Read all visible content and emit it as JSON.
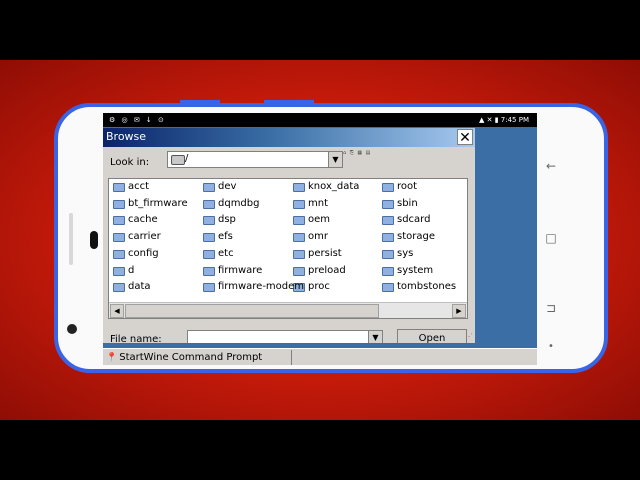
{
  "status_bar": {
    "left_icons": "⚙ ◎ ✉ ↓ ⊙",
    "right_text": "▲ ✕ ▮ 7:45 PM"
  },
  "dialog": {
    "title": "Browse",
    "close_glyph": "✕",
    "look_in_label": "Look in:",
    "look_in_value": "/",
    "toolbar_icons": "⌂ ⎘ ▦ ▤",
    "file_name_label": "File name:",
    "file_name_value": "",
    "open_button": "Open",
    "folders": [
      "acct",
      "bt_firmware",
      "cache",
      "carrier",
      "config",
      "d",
      "data",
      "dev",
      "dqmdbg",
      "dsp",
      "efs",
      "etc",
      "firmware",
      "firmware-modem",
      "knox_data",
      "mnt",
      "oem",
      "omr",
      "persist",
      "preload",
      "proc",
      "root",
      "sbin",
      "sdcard",
      "storage",
      "sys",
      "system",
      "tombstones"
    ]
  },
  "taskbar": {
    "start_label": "Start",
    "task_label": "Wine Command Prompt"
  },
  "nav": {
    "back_glyph": "←",
    "home_glyph": "□",
    "recents_glyph": "⊐",
    "dot_glyph": "•"
  },
  "colors": {
    "phone_frame": "#3a64e6",
    "background_red": "#c41a0a",
    "wine_desktop": "#3a6ea5",
    "folder_icon": "#8fb0e0"
  }
}
